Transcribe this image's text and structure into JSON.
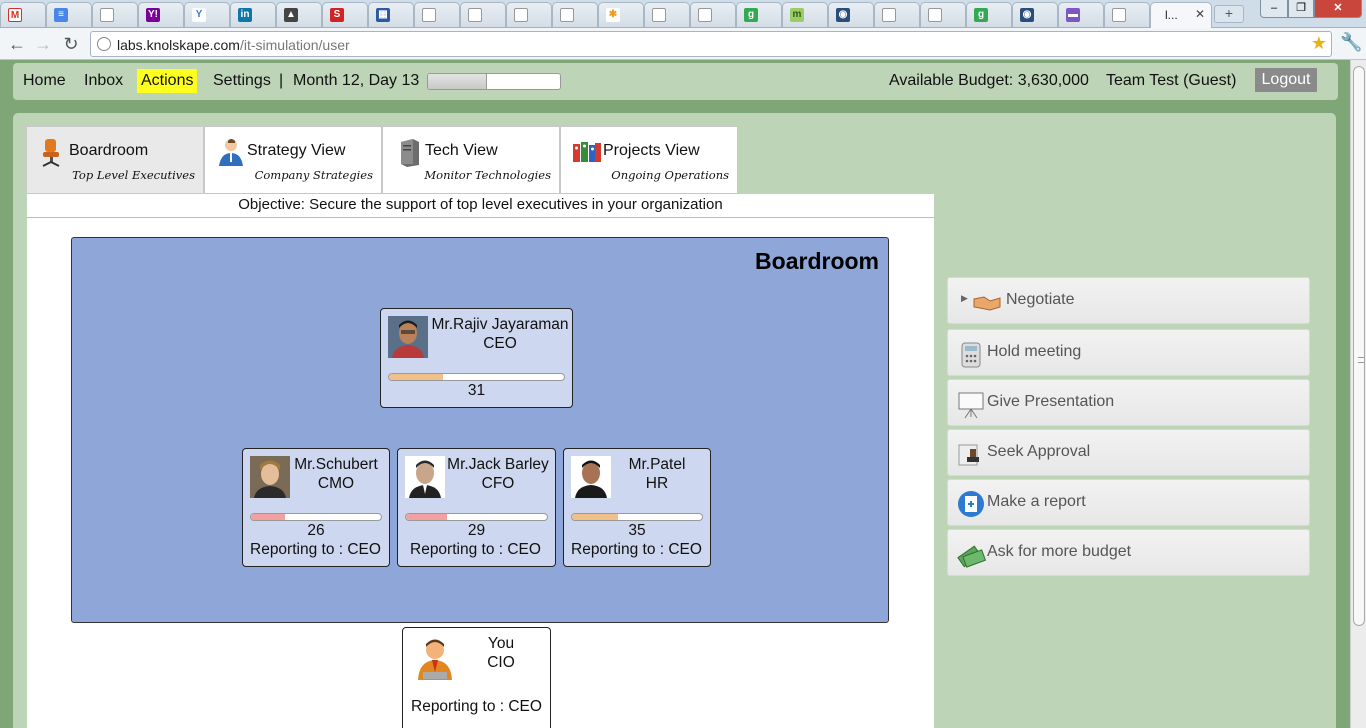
{
  "browser": {
    "active_tab_title": "l...",
    "url_host": "labs.knolskape.com",
    "url_path": "/it-simulation/user",
    "tab_favicons": [
      "gmail",
      "docs",
      "page",
      "yahoo",
      "yahoo-answers",
      "linkedin",
      "grad-cap",
      "red-s",
      "calendar-grid",
      "page",
      "page",
      "page",
      "page",
      "orange-star",
      "page",
      "page",
      "google",
      "m",
      "earth",
      "page",
      "page",
      "google",
      "earth",
      "calendar",
      "page"
    ],
    "new_tab_label": "+",
    "colors": {
      "tabbar": "#cfdde9",
      "close": "#c9463d"
    }
  },
  "topnav": {
    "home": "Home",
    "inbox": "Inbox",
    "actions": "Actions",
    "settings": "Settings",
    "separator": "|",
    "date": "Month 12, Day 13",
    "day_progress": 0.45,
    "budget": "Available Budget: 3,630,000",
    "team": "Team Test (Guest)",
    "logout": "Logout"
  },
  "view_tabs": [
    {
      "label": "Boardroom",
      "sub": "Top Level Executives",
      "icon": "office-chair-icon",
      "active": true
    },
    {
      "label": "Strategy View",
      "sub": "Company Strategies",
      "icon": "person-icon",
      "active": false
    },
    {
      "label": "Tech View",
      "sub": "Monitor Technologies",
      "icon": "server-icon",
      "active": false
    },
    {
      "label": "Projects View",
      "sub": "Ongoing Operations",
      "icon": "binders-icon",
      "active": false
    }
  ],
  "objective": "Objective: Secure the support of top level executives in your organization",
  "boardroom": {
    "title": "Boardroom",
    "ceo": {
      "name": "Mr.Rajiv Jayaraman",
      "role": "CEO",
      "score": "31",
      "support": 0.31,
      "bar_color": "#f0c08a"
    },
    "reports": [
      {
        "name": "Mr.Schubert",
        "role": "CMO",
        "score": "26",
        "support": 0.26,
        "bar_color": "#f3a0a0",
        "reporting": "Reporting to : CEO"
      },
      {
        "name": "Mr.Jack Barley",
        "role": "CFO",
        "score": "29",
        "support": 0.29,
        "bar_color": "#f3a0a0",
        "reporting": "Reporting to : CEO"
      },
      {
        "name": "Mr.Patel",
        "role": "HR",
        "score": "35",
        "support": 0.35,
        "bar_color": "#f0c08a",
        "reporting": "Reporting to : CEO"
      }
    ],
    "you": {
      "name": "You",
      "role": "CIO",
      "reporting": "Reporting to : CEO"
    }
  },
  "actions": [
    {
      "label": "Negotiate",
      "icon": "handshake-icon",
      "expandable": true
    },
    {
      "label": "Hold meeting",
      "icon": "phone-icon"
    },
    {
      "label": "Give Presentation",
      "icon": "presentation-board-icon"
    },
    {
      "label": "Seek Approval",
      "icon": "stamp-icon"
    },
    {
      "label": "Make a report",
      "icon": "report-icon"
    },
    {
      "label": "Ask for more budget",
      "icon": "money-icon"
    }
  ]
}
